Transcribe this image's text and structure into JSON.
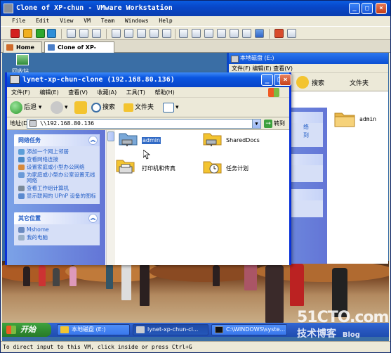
{
  "vmware": {
    "title": "Clone of XP-chun - VMware Workstation",
    "controls": [
      "_",
      "□",
      "×"
    ],
    "menu": [
      "File",
      "Edit",
      "View",
      "VM",
      "Team",
      "Windows",
      "Help"
    ],
    "tabs": [
      {
        "label": "Home"
      },
      {
        "label": "Clone of XP-chun"
      }
    ],
    "status": "To direct input to this VM, click inside or press Ctrl+G"
  },
  "guest": {
    "desktop_icon_label": "回收站",
    "bg_window": {
      "title": "本地磁盘 (E:)",
      "menu": [
        "文件(F)",
        "编辑(E)",
        "查看(V)"
      ],
      "search_label": "搜索",
      "folders_label": "文件夹",
      "link_lines": [
        "络",
        "到"
      ],
      "folder_label": "admin"
    },
    "explorer": {
      "title": "lynet-xp-chun-clone (192.168.80.136)",
      "menu": [
        "文件(F)",
        "编辑(E)",
        "查看(V)",
        "收藏(A)",
        "工具(T)",
        "帮助(H)"
      ],
      "toolbar": {
        "back": "后退",
        "search": "搜索",
        "folders": "文件夹"
      },
      "address_label": "地址(D)",
      "address_value": "\\\\192.168.80.136",
      "go_label": "转到",
      "network_tasks": {
        "title": "网络任务",
        "items": [
          "添加一个网上邻居",
          "查看网络连接",
          "设置家庭或小型办公网络",
          "为家庭或小型办公室设置无线网络",
          "查看工作组计算机",
          "显示联网的 UPnP 设备的图标"
        ]
      },
      "other_places": {
        "title": "其它位置",
        "items": [
          "Mshome",
          "我的电脑"
        ]
      },
      "shares": [
        {
          "label": "admin",
          "selected": true
        },
        {
          "label": "SharedDocs",
          "selected": false
        },
        {
          "label": "打印机和传真",
          "selected": false
        },
        {
          "label": "任务计划",
          "selected": false
        }
      ]
    },
    "taskbar": {
      "start": "开始",
      "buttons": [
        "本地磁盘 (E:)",
        "lynet-xp-chun-cl...",
        "C:\\WINDOWS\\syste..."
      ]
    },
    "watermark": {
      "line1": "51CTO.com",
      "line2": "技术博客",
      "line3": "Blog"
    }
  }
}
